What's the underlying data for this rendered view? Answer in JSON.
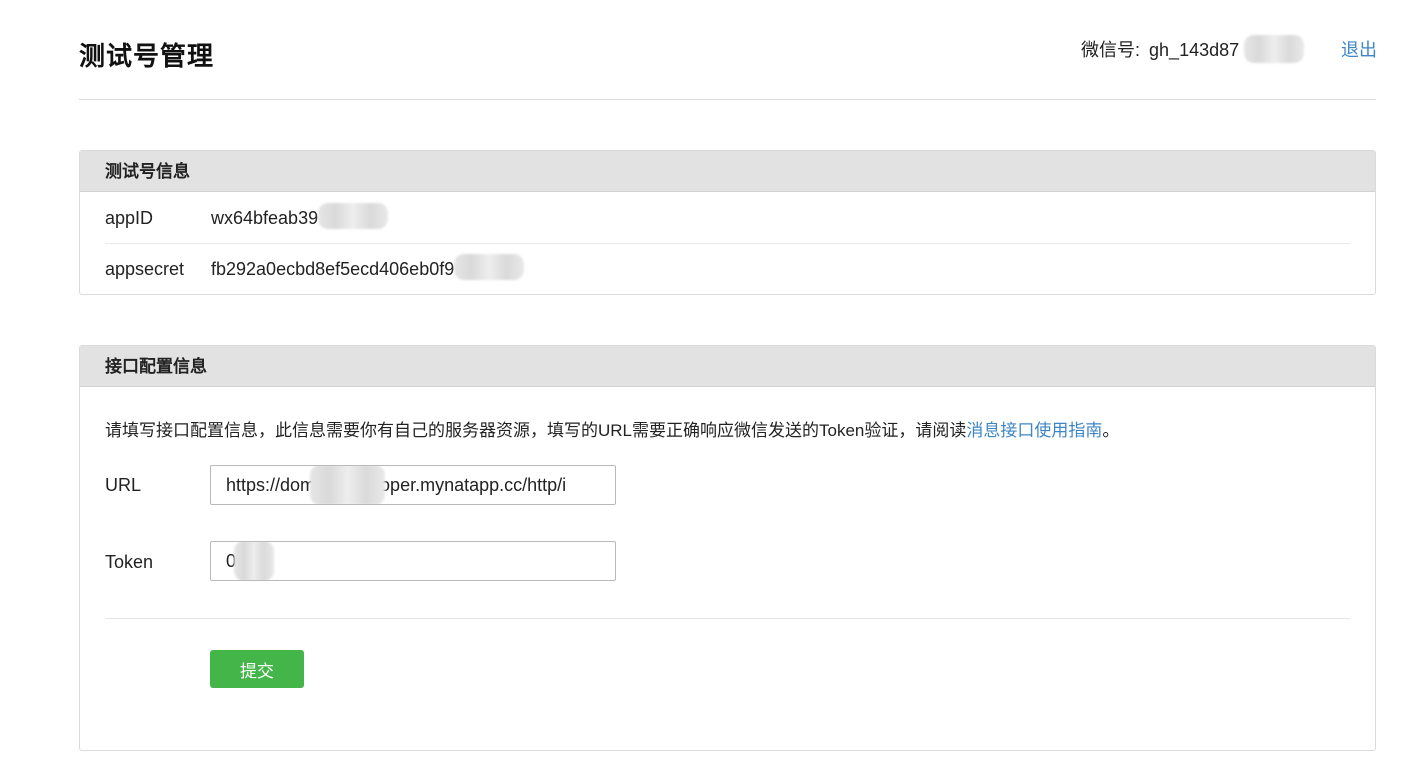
{
  "header": {
    "title": "测试号管理",
    "account_label": "微信号:",
    "account_value": "gh_143d87",
    "logout_label": "退出"
  },
  "info_panel": {
    "title": "测试号信息",
    "rows": [
      {
        "key": "appID",
        "value": "wx64bfeab39"
      },
      {
        "key": "appsecret",
        "value": "fb292a0ecbd8ef5ecd406eb0f9"
      }
    ]
  },
  "config_panel": {
    "title": "接口配置信息",
    "description": "请填写接口配置信息，此信息需要你有自己的服务器资源，填写的URL需要正确响应微信发送的Token验证，请阅读",
    "guide_link": "消息接口使用指南",
    "description_end": "。",
    "url_label": "URL",
    "url_value_start": "https://dom",
    "url_value_end": "oper.mynatapp.cc/http/i",
    "token_label": "Token",
    "token_value": "0",
    "submit_label": "提交"
  },
  "colors": {
    "link": "#3d86c6",
    "submit": "#44b549",
    "panel_header": "#e2e2e2"
  }
}
